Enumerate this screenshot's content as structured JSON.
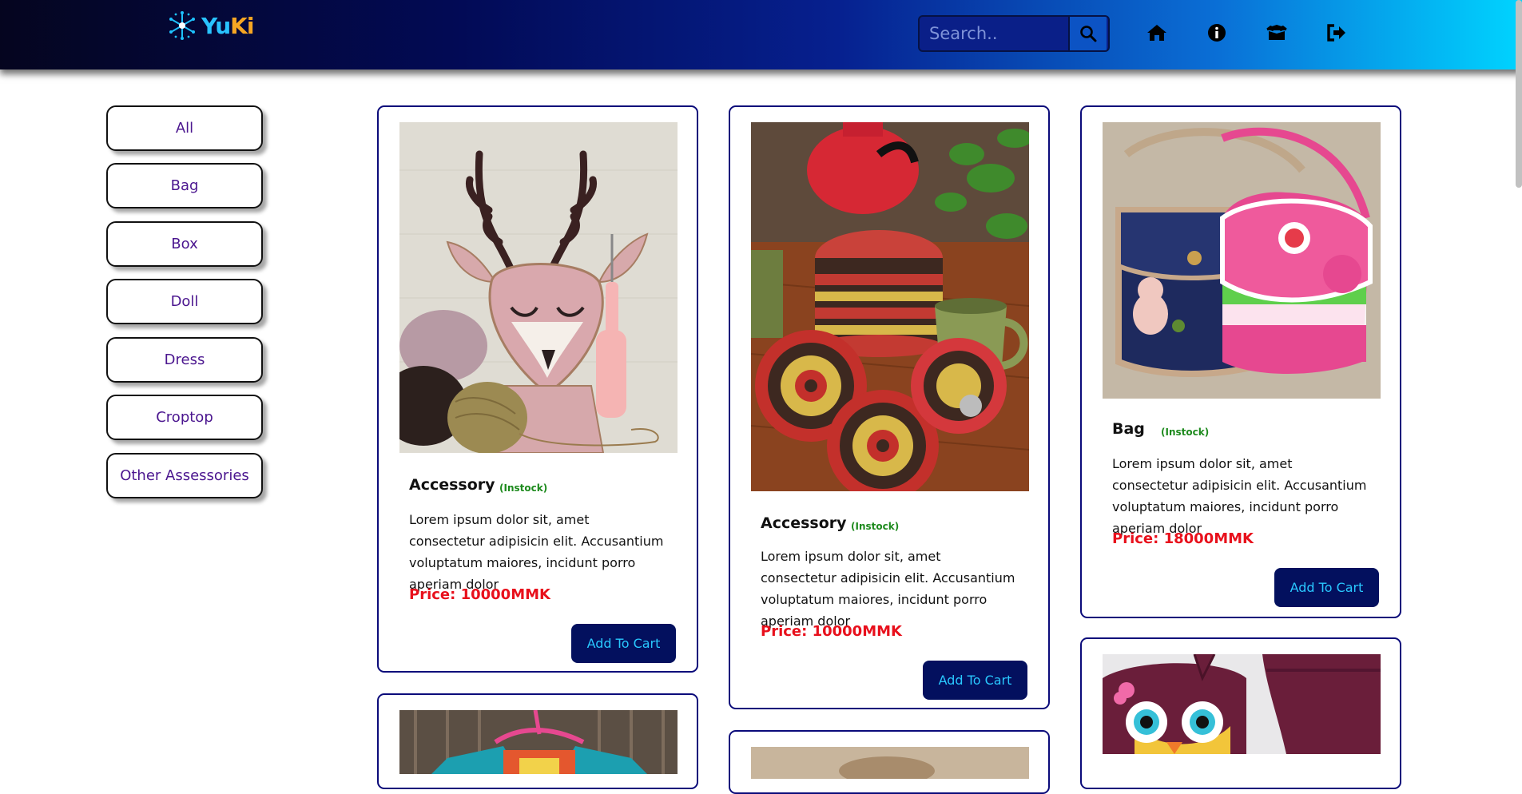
{
  "header": {
    "brand_part1": "Yu",
    "brand_part2": "Ki",
    "search_placeholder": "Search..",
    "icons": [
      "search-icon",
      "home-icon",
      "info-icon",
      "box-icon",
      "logout-icon"
    ]
  },
  "colors": {
    "header_gradient_start": "#05051f",
    "header_gradient_end": "#00d4ff",
    "category_text": "#4b168f",
    "card_border": "#0b0b7a",
    "price": "#e8101c",
    "instock": "#1d8a1d",
    "button_bg": "#03105e",
    "button_text": "#29c8ff"
  },
  "categories": [
    "All",
    "Bag",
    "Box",
    "Doll",
    "Dress",
    "Croptop",
    "Other Assessories"
  ],
  "products": [
    {
      "name": "Accessory",
      "stock": "(Instock)",
      "desc": "Lorem ipsum dolor sit, amet consectetur adipisicin elit. Accusantium voluptatum maiores, incidunt porro aperiam dolor",
      "price": "Price: 10000MMK",
      "button": "Add To Cart"
    },
    {
      "name": "Accessory",
      "stock": "(Instock)",
      "desc": "Lorem ipsum dolor sit, amet consectetur adipisicin elit. Accusantium voluptatum maiores, incidunt porro aperiam dolor",
      "price": "Price: 10000MMK",
      "button": "Add To Cart"
    },
    {
      "name": "Bag",
      "stock": "(Instock)",
      "desc": "Lorem ipsum dolor sit, amet consectetur adipisicin elit. Accusantium voluptatum maiores, incidunt porro aperiam dolor",
      "price": "Price: 18000MMK",
      "button": "Add To Cart"
    }
  ]
}
